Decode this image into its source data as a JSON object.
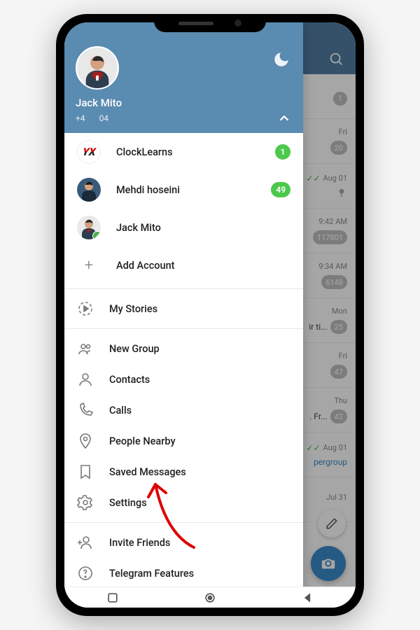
{
  "header": {
    "profile_name": "Jack Mito",
    "phone_prefix": "+4",
    "phone_suffix": "04"
  },
  "accounts": [
    {
      "label": "ClockLearns",
      "badge": "1",
      "logo": "YX"
    },
    {
      "label": "Mehdi hoseini",
      "badge": "49"
    },
    {
      "label": "Jack Mito",
      "verified": true
    },
    {
      "label": "Add Account"
    }
  ],
  "menu": {
    "my_stories": "My Stories",
    "new_group": "New Group",
    "contacts": "Contacts",
    "calls": "Calls",
    "people_nearby": "People Nearby",
    "saved_messages": "Saved Messages",
    "settings": "Settings",
    "invite_friends": "Invite Friends",
    "telegram_features": "Telegram Features"
  },
  "bg_chats": [
    {
      "time": "",
      "badge": "1"
    },
    {
      "time": "Fri",
      "badge": "20"
    },
    {
      "time": "Aug 01",
      "checks": true,
      "pin": true
    },
    {
      "time": "9:42 AM",
      "badge": "117801"
    },
    {
      "time": "9:34 AM",
      "badge": "6148"
    },
    {
      "time": "Mon",
      "badge": "25",
      "text": "ir ti..."
    },
    {
      "time": "Fri",
      "badge": "47"
    },
    {
      "time": "Thu",
      "badge": "42",
      "text": ". Fr..."
    },
    {
      "time": "Aug 01",
      "checks": true,
      "text_blue": "pergroup"
    },
    {
      "time": "Jul 31"
    }
  ]
}
